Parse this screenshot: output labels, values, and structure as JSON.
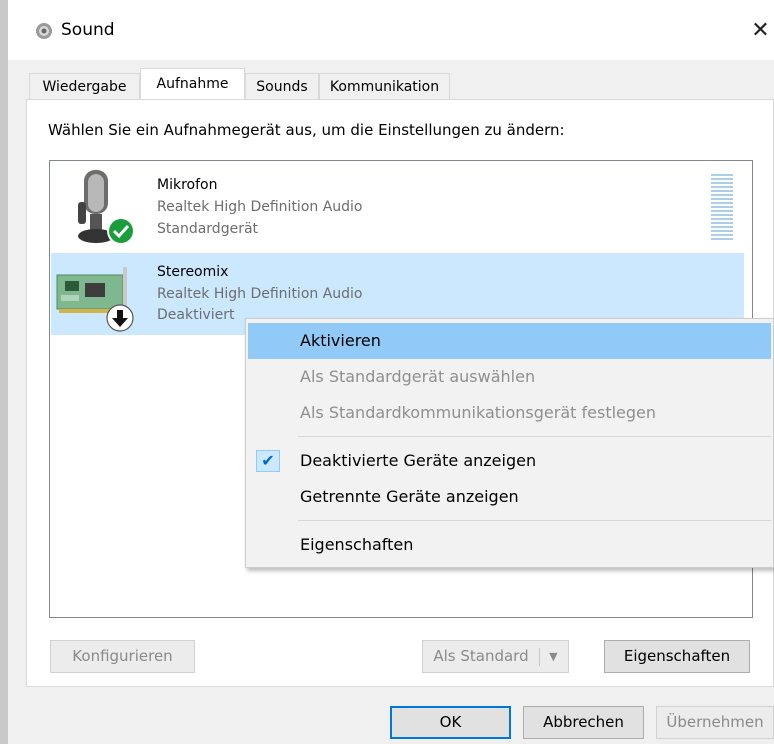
{
  "window": {
    "title": "Sound",
    "close_glyph": "✕"
  },
  "tabs": [
    {
      "label": "Wiedergabe"
    },
    {
      "label": "Aufnahme",
      "selected": true
    },
    {
      "label": "Sounds"
    },
    {
      "label": "Kommunikation"
    }
  ],
  "instruction": "Wählen Sie ein Aufnahmegerät aus, um die Einstellungen zu ändern:",
  "devices": [
    {
      "name": "Mikrofon",
      "driver": "Realtek High Definition Audio",
      "status": "Standardgerät",
      "icon": "microphone-icon",
      "badge": "default-check-icon"
    },
    {
      "name": "Stereomix",
      "driver": "Realtek High Definition Audio",
      "status": "Deaktiviert",
      "icon": "sound-card-icon",
      "badge": "disabled-arrow-icon",
      "selected": true
    }
  ],
  "context_menu": {
    "items": [
      {
        "label": "Aktivieren",
        "state": "highlighted"
      },
      {
        "label": "Als Standardgerät auswählen",
        "state": "disabled"
      },
      {
        "label": "Als Standardkommunikationsgerät festlegen",
        "state": "disabled"
      },
      {
        "label": "Deaktivierte Geräte anzeigen",
        "state": "checked"
      },
      {
        "label": "Getrennte Geräte anzeigen",
        "state": "normal"
      },
      {
        "label": "Eigenschaften",
        "state": "normal"
      }
    ]
  },
  "buttons": {
    "configure": "Konfigurieren",
    "set_default": "Als Standard",
    "properties": "Eigenschaften",
    "ok": "OK",
    "cancel": "Abbrechen",
    "apply": "Übernehmen"
  },
  "colors": {
    "selection": "#cce8ff",
    "menu_highlight": "#91c9f7",
    "accent": "#0078d7",
    "check_badge": "#1a9e3c"
  }
}
